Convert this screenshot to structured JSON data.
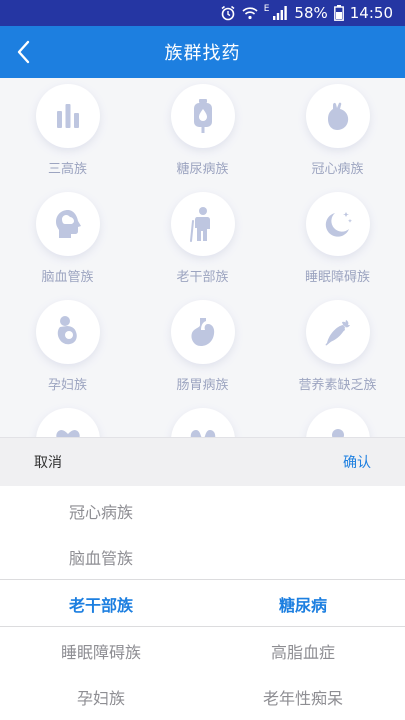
{
  "status_bar": {
    "battery": "58%",
    "time": "14:50",
    "network": "E"
  },
  "header": {
    "title": "族群找药"
  },
  "grid": [
    {
      "label": "三高族",
      "icon": "bar-chart-icon"
    },
    {
      "label": "糖尿病族",
      "icon": "iv-drip-icon"
    },
    {
      "label": "冠心病族",
      "icon": "heart-organ-icon"
    },
    {
      "label": "脑血管族",
      "icon": "brain-head-icon"
    },
    {
      "label": "老干部族",
      "icon": "elderly-person-icon"
    },
    {
      "label": "睡眠障碍族",
      "icon": "moon-stars-icon"
    },
    {
      "label": "孕妇族",
      "icon": "pregnant-woman-icon"
    },
    {
      "label": "肠胃病族",
      "icon": "stomach-icon"
    },
    {
      "label": "营养素缺乏族",
      "icon": "carrot-icon"
    }
  ],
  "picker": {
    "cancel_label": "取消",
    "confirm_label": "确认",
    "left_column": [
      "冠心病族",
      "脑血管族",
      "老干部族",
      "睡眠障碍族",
      "孕妇族"
    ],
    "right_column": [
      "",
      "",
      "糖尿病",
      "高脂血症",
      "老年性痴呆"
    ],
    "selected_index": 2
  },
  "colors": {
    "primary": "#1d7fe0",
    "status_bar": "#2536a3",
    "icon": "#b6bfdc",
    "label": "#8f98b8"
  }
}
